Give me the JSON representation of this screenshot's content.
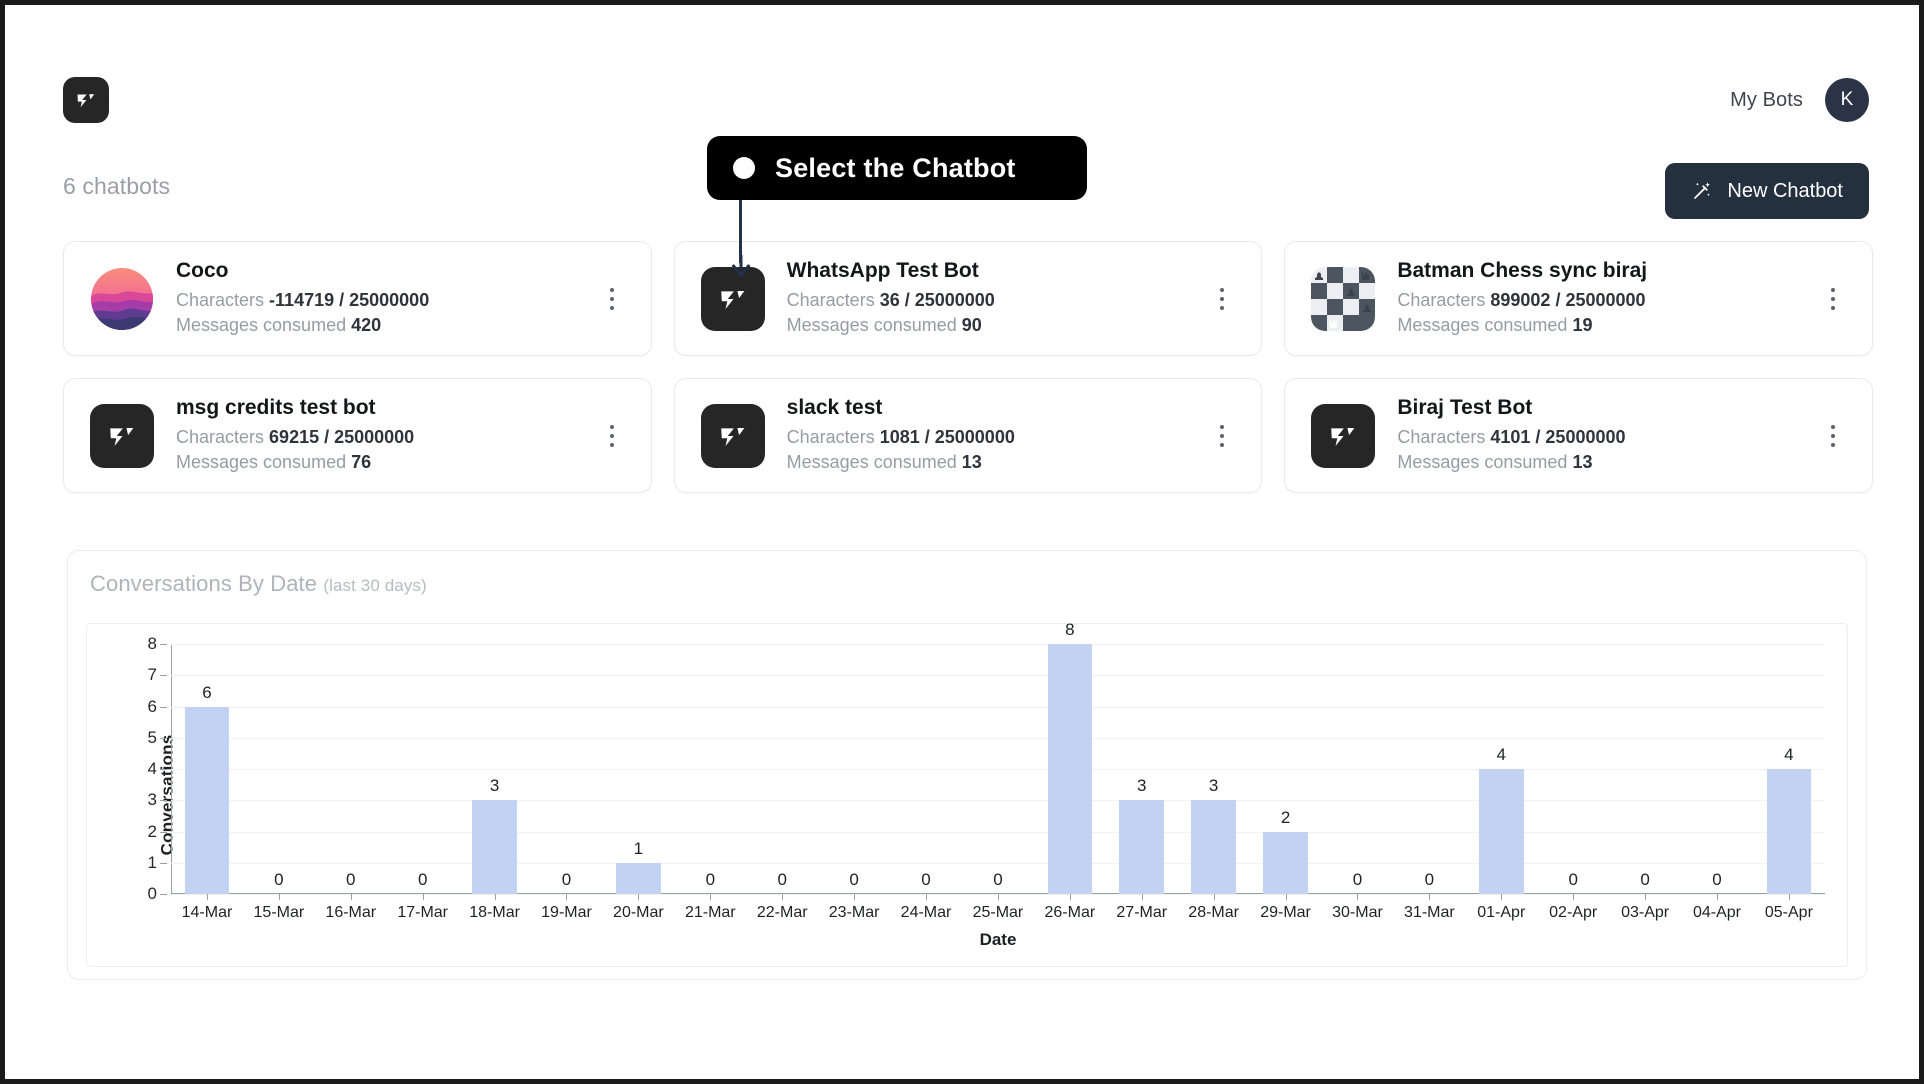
{
  "header": {
    "logo_icon": "brand-logo-icon",
    "my_bots_label": "My Bots",
    "avatar_initial": "K"
  },
  "subheader": {
    "count_label": "6 chatbots",
    "new_chatbot_label": "New Chatbot",
    "new_chatbot_icon": "magic-wand-icon"
  },
  "callout": {
    "text": "Select the Chatbot",
    "dot_icon": "bullet-dot-icon",
    "arrow_icon": "down-arrow-icon"
  },
  "bots": [
    {
      "name": "Coco",
      "characters_label": "Characters",
      "characters_value": "-114719 / 25000000",
      "messages_label": "Messages consumed",
      "messages_value": "420",
      "avatar_type": "gradient",
      "menu_icon": "kebab-menu-icon"
    },
    {
      "name": "WhatsApp Test Bot",
      "characters_label": "Characters",
      "characters_value": "36 / 25000000",
      "messages_label": "Messages consumed",
      "messages_value": "90",
      "avatar_type": "logo",
      "menu_icon": "kebab-menu-icon"
    },
    {
      "name": "Batman Chess sync biraj",
      "characters_label": "Characters",
      "characters_value": "899002 / 25000000",
      "messages_label": "Messages consumed",
      "messages_value": "19",
      "avatar_type": "chess",
      "menu_icon": "kebab-menu-icon"
    },
    {
      "name": "msg credits test bot",
      "characters_label": "Characters",
      "characters_value": "69215 / 25000000",
      "messages_label": "Messages consumed",
      "messages_value": "76",
      "avatar_type": "logo",
      "menu_icon": "kebab-menu-icon"
    },
    {
      "name": "slack test",
      "characters_label": "Characters",
      "characters_value": "1081 / 25000000",
      "messages_label": "Messages consumed",
      "messages_value": "13",
      "avatar_type": "logo",
      "menu_icon": "kebab-menu-icon"
    },
    {
      "name": "Biraj Test Bot",
      "characters_label": "Characters",
      "characters_value": "4101 / 25000000",
      "messages_label": "Messages consumed",
      "messages_value": "13",
      "avatar_type": "logo",
      "menu_icon": "kebab-menu-icon"
    }
  ],
  "chart_panel": {
    "title": "Conversations By Date",
    "subtitle": "(last 30 days)"
  },
  "chart_data": {
    "type": "bar",
    "title": "Conversations By Date (last 30 days)",
    "xlabel": "Date",
    "ylabel": "Conversations",
    "ylim": [
      0,
      8
    ],
    "yticks": [
      0,
      1,
      2,
      3,
      4,
      5,
      6,
      7,
      8
    ],
    "grid": true,
    "legend": "none",
    "bar_color": "#c3d2f2",
    "show_value_labels": true,
    "categories": [
      "14-Mar",
      "15-Mar",
      "16-Mar",
      "17-Mar",
      "18-Mar",
      "19-Mar",
      "20-Mar",
      "21-Mar",
      "22-Mar",
      "23-Mar",
      "24-Mar",
      "25-Mar",
      "26-Mar",
      "27-Mar",
      "28-Mar",
      "29-Mar",
      "30-Mar",
      "31-Mar",
      "01-Apr",
      "02-Apr",
      "03-Apr",
      "04-Apr",
      "05-Apr"
    ],
    "values": [
      6,
      0,
      0,
      0,
      3,
      0,
      1,
      0,
      0,
      0,
      0,
      0,
      8,
      3,
      3,
      2,
      0,
      0,
      4,
      0,
      0,
      0,
      4
    ]
  },
  "colors": {
    "brand_dark": "#262626",
    "accent_button": "#25303f",
    "bar_blue": "#c3d2f2",
    "callout_black": "#000000",
    "avatar_navy": "#2b3446"
  }
}
